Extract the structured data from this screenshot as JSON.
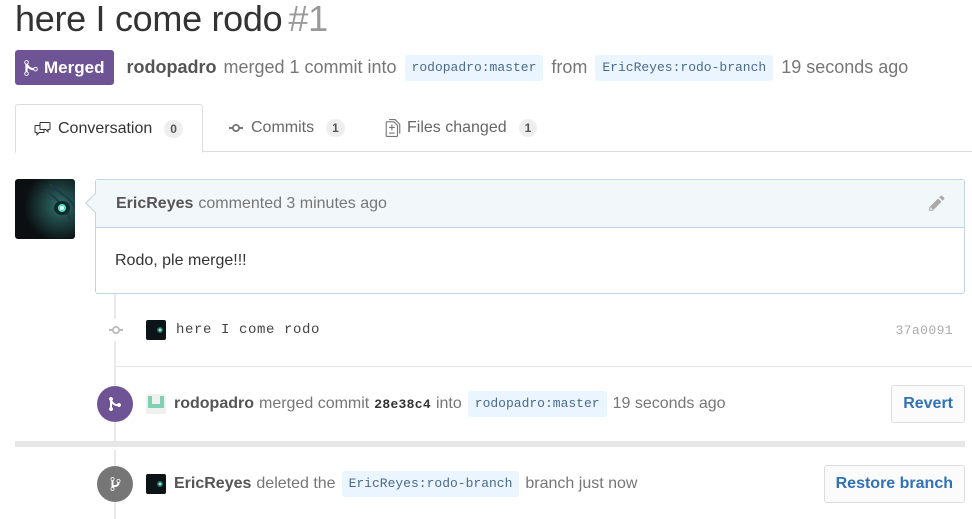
{
  "pr": {
    "title": "here I come rodo",
    "number": "#1",
    "state_label": "Merged",
    "merger": "rodopadro",
    "summary_text": "merged 1 commit into",
    "base_ref": "rodopadro:master",
    "from_word": "from",
    "head_ref": "EricReyes:rodo-branch",
    "time": "19 seconds ago"
  },
  "tabs": [
    {
      "label": "Conversation",
      "count": "0",
      "icon": "comment-discussion-icon"
    },
    {
      "label": "Commits",
      "count": "1",
      "icon": "git-commit-icon"
    },
    {
      "label": "Files changed",
      "count": "1",
      "icon": "diff-icon"
    }
  ],
  "comment": {
    "author": "EricReyes",
    "action": "commented 3 minutes ago",
    "body": "Rodo, ple merge!!!"
  },
  "commit": {
    "message": "here I come rodo",
    "sha": "37a0091"
  },
  "merge_event": {
    "actor": "rodopadro",
    "text_merged": "merged commit",
    "sha": "28e38c4",
    "into": "into",
    "ref": "rodopadro:master",
    "time": "19 seconds ago",
    "button": "Revert"
  },
  "delete_event": {
    "actor": "EricReyes",
    "text_deleted": "deleted the",
    "ref": "EricReyes:rodo-branch",
    "suffix": "branch just now",
    "button": "Restore branch"
  },
  "colors": {
    "merged_purple": "#6e5494",
    "link_blue": "#3072b5",
    "ref_bg": "#eaf5ff",
    "deleted_gray": "#767676"
  }
}
